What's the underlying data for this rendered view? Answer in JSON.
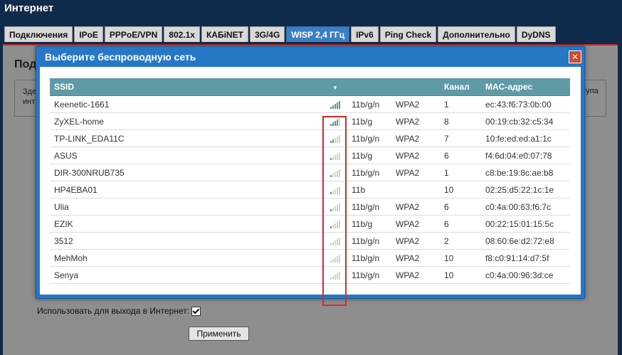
{
  "app": {
    "title": "Интернет"
  },
  "tabs": [
    {
      "label": "Подключения",
      "active": false
    },
    {
      "label": "IPoE",
      "active": false
    },
    {
      "label": "PPPoE/VPN",
      "active": false
    },
    {
      "label": "802.1x",
      "active": false
    },
    {
      "label": "КАБiNET",
      "active": false
    },
    {
      "label": "3G/4G",
      "active": false
    },
    {
      "label": "WISP 2,4 ГГц",
      "active": true
    },
    {
      "label": "IPv6",
      "active": false
    },
    {
      "label": "Ping Check",
      "active": false
    },
    {
      "label": "Дополнительно",
      "active": false
    },
    {
      "label": "DyDNS",
      "active": false
    }
  ],
  "background": {
    "heading": "Под",
    "info_left_1": "Зде",
    "info_left_2": "инт",
    "info_right": "тупа",
    "use_internet_label": "Использовать для выхода в Интернет:",
    "use_internet_checked": true,
    "apply_label": "Применить"
  },
  "dialog": {
    "title": "Выберите беспроводную сеть",
    "close_icon": "close-icon",
    "columns": {
      "ssid": "SSID",
      "signal_sort_icon": "▼",
      "mode": "",
      "security": "",
      "channel": "Канал",
      "mac": "MAC-адрес"
    },
    "networks": [
      {
        "ssid": "Keenetic-1661",
        "signal": 5,
        "mode": "11b/g/n",
        "security": "WPA2",
        "channel": "1",
        "mac": "ec:43:f6:73:0b:00"
      },
      {
        "ssid": "ZyXEL-home",
        "signal": 4,
        "mode": "11b/g",
        "security": "WPA2",
        "channel": "8",
        "mac": "00:19:cb:32:c5:34"
      },
      {
        "ssid": "TP-LINK_EDA11C",
        "signal": 2,
        "mode": "11b/g/n",
        "security": "WPA2",
        "channel": "7",
        "mac": "10:fe:ed:ed:a1:1c"
      },
      {
        "ssid": "ASUS",
        "signal": 1,
        "mode": "11b/g",
        "security": "WPA2",
        "channel": "6",
        "mac": "f4:6d:04:e0:07:78"
      },
      {
        "ssid": "DIR-300NRUB735",
        "signal": 1,
        "mode": "11b/g/n",
        "security": "WPA2",
        "channel": "1",
        "mac": "c8:be:19:8c:ae:b8"
      },
      {
        "ssid": "HP4EBA01",
        "signal": 1,
        "mode": "11b",
        "security": "",
        "channel": "10",
        "mac": "02:25:d5:22:1c:1e"
      },
      {
        "ssid": "Ulia",
        "signal": 1,
        "mode": "11b/g/n",
        "security": "WPA2",
        "channel": "6",
        "mac": "c0:4a:00:63:f6:7c"
      },
      {
        "ssid": "EZIK",
        "signal": 1,
        "mode": "11b/g",
        "security": "WPA2",
        "channel": "6",
        "mac": "00:22:15:01:15:5c"
      },
      {
        "ssid": "3512",
        "signal": 0,
        "mode": "11b/g/n",
        "security": "WPA2",
        "channel": "2",
        "mac": "08:60:6e:d2:72:e8"
      },
      {
        "ssid": "MehMoh",
        "signal": 0,
        "mode": "11b/g/n",
        "security": "WPA2",
        "channel": "10",
        "mac": "f8:c0:91:14:d7:5f"
      },
      {
        "ssid": "Senya",
        "signal": 0,
        "mode": "11b/g/n",
        "security": "WPA2",
        "channel": "10",
        "mac": "c0:4a:00:96:3d:ce"
      }
    ]
  },
  "colors": {
    "accent": "#2777c7",
    "header": "#5f9ba6",
    "highlight": "#d12b2b"
  }
}
